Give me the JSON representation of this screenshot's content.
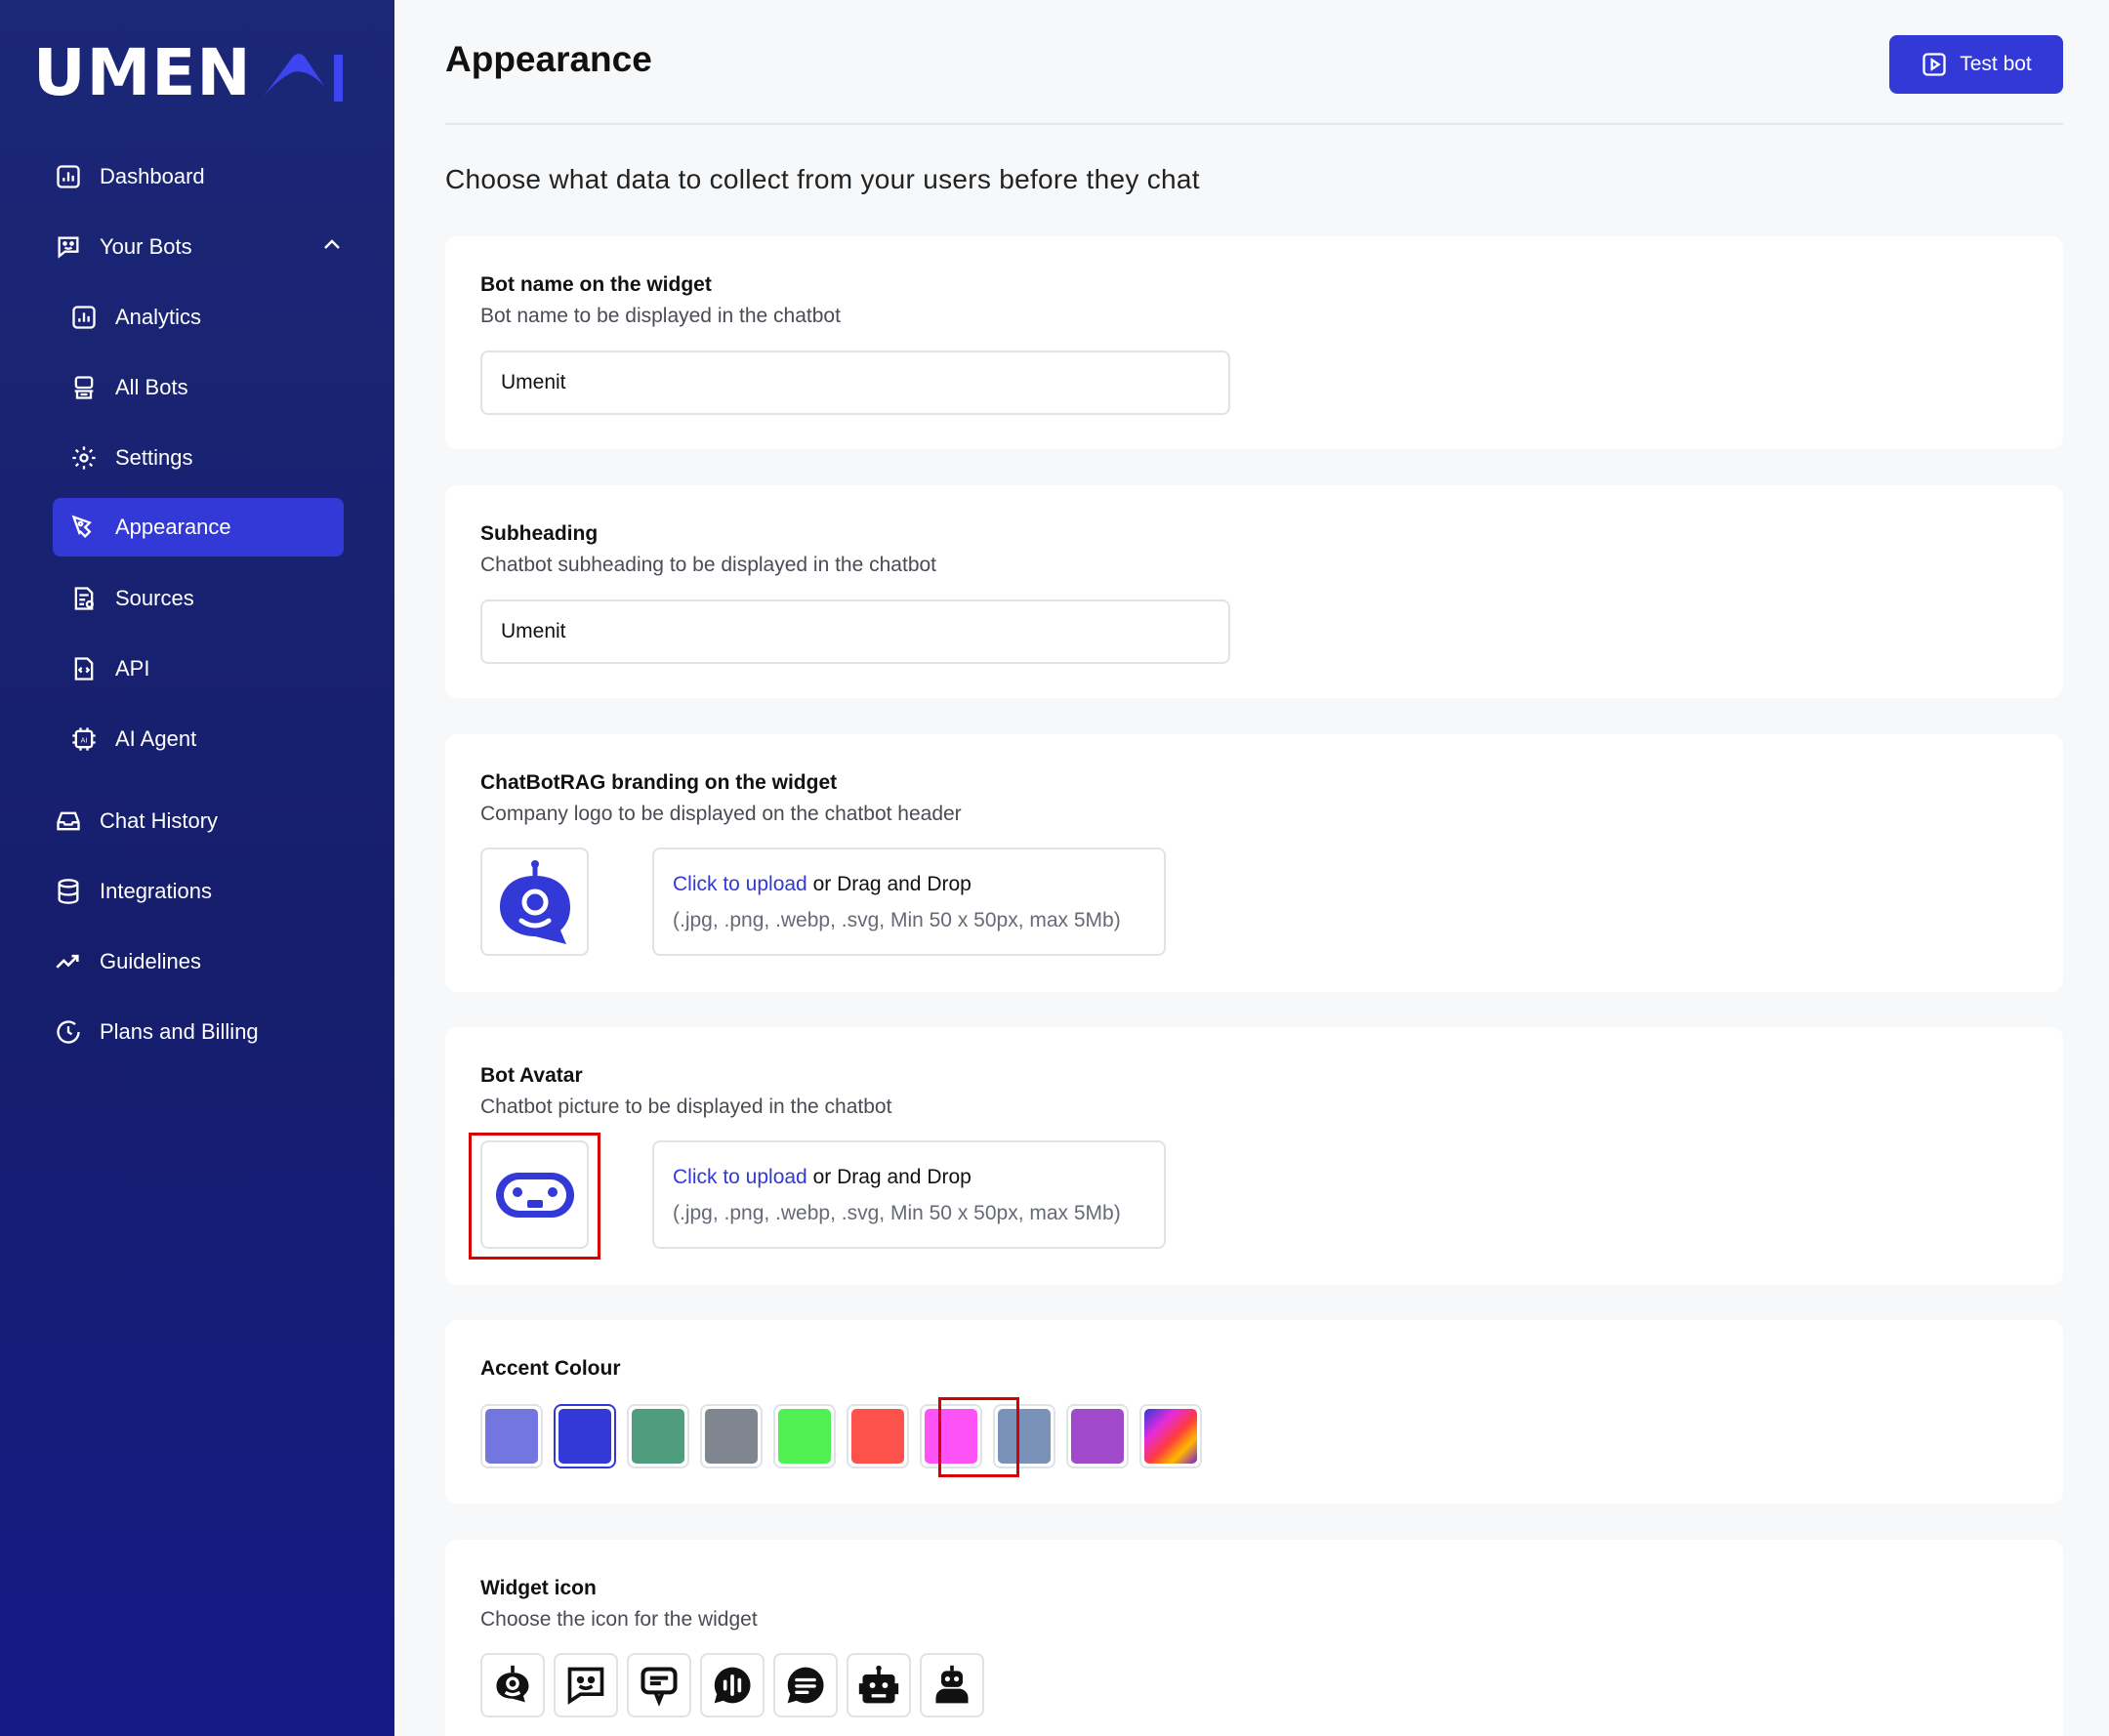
{
  "brand": {
    "logo_text": "UMEN",
    "logo_mark": "AI"
  },
  "sidebar": {
    "items": [
      {
        "label": "Dashboard",
        "icon": "chart-icon"
      },
      {
        "label": "Your Bots",
        "icon": "bot-chat-icon"
      },
      {
        "label": "Analytics",
        "icon": "chart-icon"
      },
      {
        "label": "All Bots",
        "icon": "robot-icon"
      },
      {
        "label": "Settings",
        "icon": "gear-icon"
      },
      {
        "label": "Appearance",
        "icon": "pen-icon"
      },
      {
        "label": "Sources",
        "icon": "document-icon"
      },
      {
        "label": "API",
        "icon": "code-file-icon"
      },
      {
        "label": "AI Agent",
        "icon": "chip-icon"
      },
      {
        "label": "Chat History",
        "icon": "inbox-icon"
      },
      {
        "label": "Integrations",
        "icon": "database-icon"
      },
      {
        "label": "Guidelines",
        "icon": "trend-icon"
      },
      {
        "label": "Plans and Billing",
        "icon": "clock-icon"
      }
    ]
  },
  "header": {
    "title": "Appearance",
    "test_button": "Test bot"
  },
  "intro": "Choose what data to collect from your users before they chat",
  "sections": {
    "bot_name": {
      "title": "Bot name on the widget",
      "subtitle": "Bot name to be displayed in the chatbot",
      "value": "Umenit"
    },
    "subheading": {
      "title": "Subheading",
      "subtitle": "Chatbot subheading to be displayed in the chatbot",
      "value": "Umenit"
    },
    "branding": {
      "title": "ChatBotRAG branding on the widget",
      "subtitle": "Company logo to be displayed on the chatbot header",
      "upload_link": "Click to upload",
      "upload_text": " or Drag and Drop",
      "upload_hint": "(.jpg, .png, .webp, .svg, Min 50 x 50px, max 5Mb)"
    },
    "avatar": {
      "title": "Bot Avatar",
      "subtitle": "Chatbot picture to be displayed in the chatbot",
      "upload_link": "Click to upload",
      "upload_text": " or Drag and Drop",
      "upload_hint": "(.jpg, .png, .webp, .svg, Min 50 x 50px, max 5Mb)"
    },
    "accent": {
      "title": "Accent Colour",
      "colors": [
        "#7476e0",
        "#3339d6",
        "#4f9c7e",
        "#80868f",
        "#50f052",
        "#fd524c",
        "#fd52f5",
        "#7b92b8",
        "#a049cb",
        "gradient"
      ],
      "selected_index": 1
    },
    "widget_icon": {
      "title": "Widget icon",
      "subtitle": "Choose the icon for the widget",
      "icons": [
        "bot-face-bubble-icon",
        "smile-chat-icon",
        "chat-screen-icon",
        "voice-bubble-icon",
        "message-lines-icon",
        "robot-head-icon",
        "robot-bust-icon"
      ]
    }
  },
  "colors": {
    "primary": "#3339d6",
    "sidebar_bg": "#1a2374",
    "highlight": "#d60000"
  }
}
